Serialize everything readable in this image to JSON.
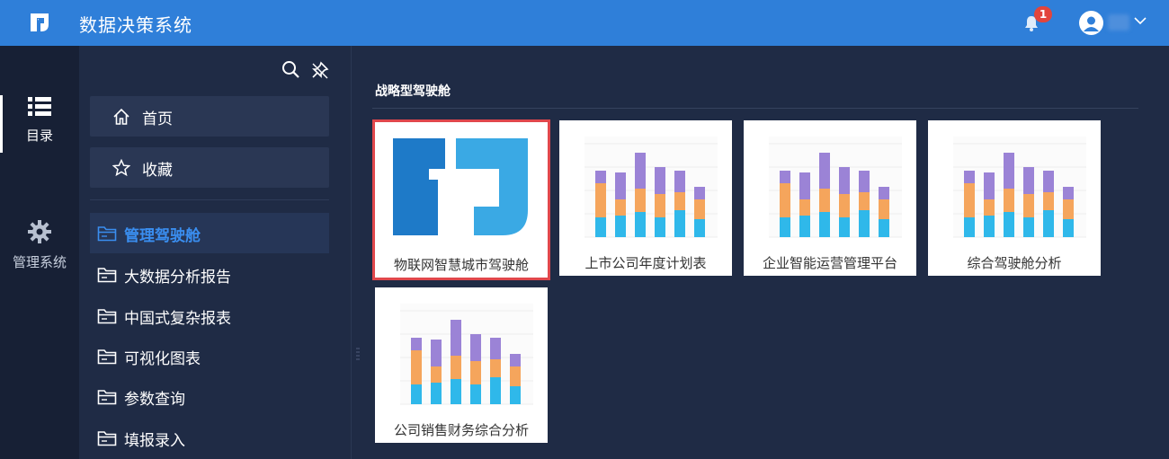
{
  "app": {
    "title": "数据决策系统",
    "notification_count": "1"
  },
  "rail": {
    "directory_label": "目录",
    "management_label": "管理系统"
  },
  "panel": {
    "quick": [
      {
        "label": "首页"
      },
      {
        "label": "收藏"
      }
    ],
    "folders": [
      {
        "label": "管理驾驶舱",
        "active": true
      },
      {
        "label": "大数据分析报告"
      },
      {
        "label": "中国式复杂报表"
      },
      {
        "label": "可视化图表"
      },
      {
        "label": "参数查询"
      },
      {
        "label": "填报录入"
      }
    ]
  },
  "main": {
    "section_title": "战略型驾驶舱",
    "cards": [
      {
        "label": "物联网智慧城市驾驶舱",
        "thumbnail": "logo",
        "selected": true
      },
      {
        "label": "上市公司年度计划表",
        "thumbnail": "stacked-bar"
      },
      {
        "label": "企业智能运营管理平台",
        "thumbnail": "stacked-bar"
      },
      {
        "label": "综合驾驶舱分析",
        "thumbnail": "stacked-bar"
      },
      {
        "label": "公司销售财务综合分析",
        "thumbnail": "stacked-bar"
      }
    ]
  },
  "colors": {
    "header": "#2f7fd9",
    "accent": "#3a8ef0",
    "selected_outline": "#e0474c",
    "bar_blue": "#2fb8ea",
    "bar_orange": "#f5a55c",
    "bar_purple": "#9b83d6"
  }
}
